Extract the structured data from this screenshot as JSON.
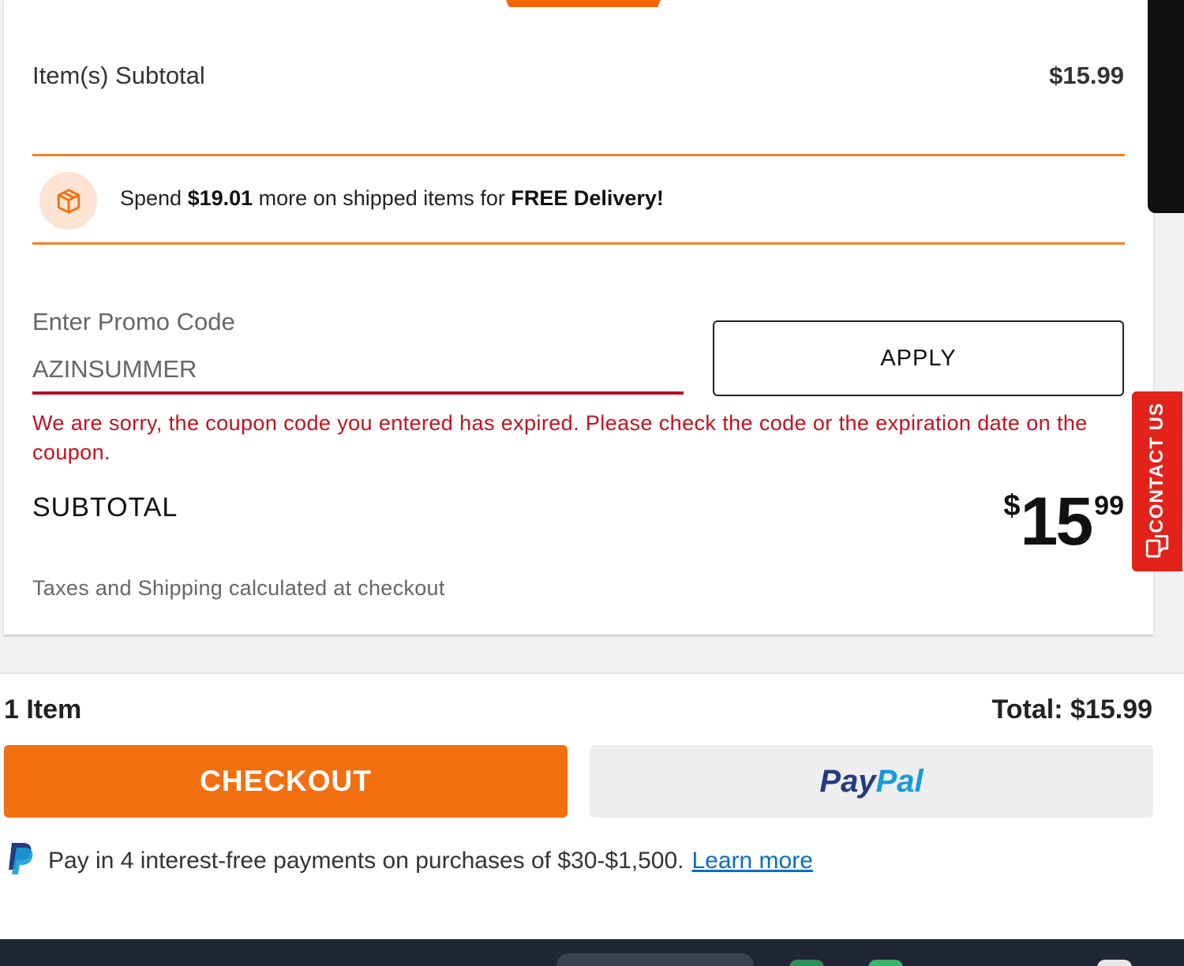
{
  "summary": {
    "items_subtotal_label": "Item(s) Subtotal",
    "items_subtotal_value": "$15.99"
  },
  "delivery_banner": {
    "icon": "package-box-icon",
    "text_prefix": "Spend ",
    "amount": "$19.01",
    "text_middle": " more on shipped items for ",
    "highlight": "FREE Delivery!"
  },
  "promo": {
    "label": "Enter Promo Code",
    "input_value": "AZINSUMMER",
    "apply_label": "APPLY",
    "error": "We are sorry, the coupon code you entered has expired. Please check the code or the expiration date on the coupon."
  },
  "subtotal": {
    "label": "SUBTOTAL",
    "currency": "$",
    "dollars": "15",
    "cents": "99",
    "tax_note": "Taxes and Shipping calculated at checkout"
  },
  "side_tab": {
    "label": "CONTACT US",
    "icon": "chat-bubbles-icon"
  },
  "footer": {
    "item_count": "1 Item",
    "total": "Total: $15.99",
    "checkout_label": "CHECKOUT",
    "paypal_label_1": "Pay",
    "paypal_label_2": "Pal",
    "pay_later_text": "Pay in 4 interest-free payments on purchases of $30-$1,500.",
    "learn_more": "Learn more"
  },
  "colors": {
    "brand_orange": "#f96302",
    "error_red": "#c1121f",
    "contact_red": "#e2231a",
    "paypal_dark": "#253b80",
    "paypal_light": "#179bd7"
  }
}
